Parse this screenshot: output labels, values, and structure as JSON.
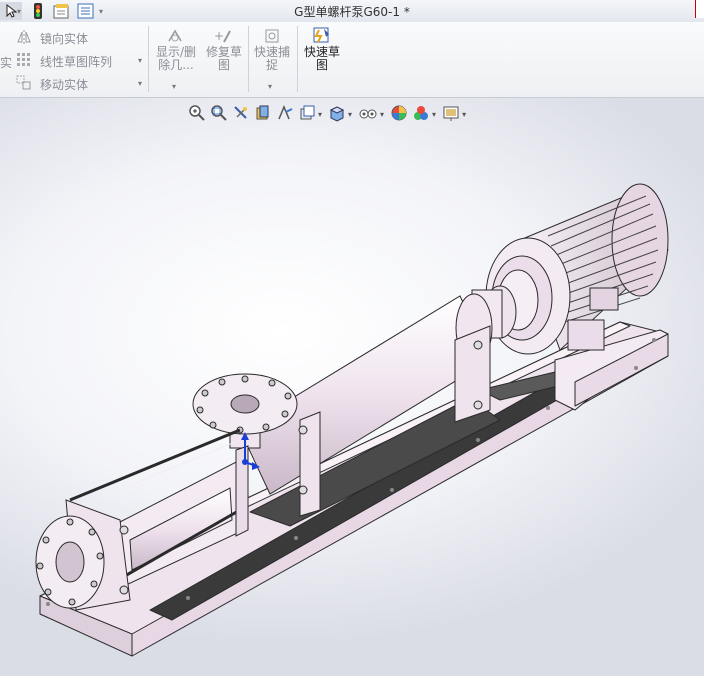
{
  "window": {
    "title": "G型单螺杆泵G60-1 *"
  },
  "quick_access": {
    "icons": [
      "select-arrow-icon",
      "traffic-light-icon",
      "file-properties-icon",
      "options-list-icon"
    ]
  },
  "ribbon": {
    "left_cut_label": "实",
    "mirror_label": "镜向实体",
    "linear_pattern_label": "线性草图阵列",
    "move_label": "移动实体",
    "display_delete_label": "显示/删除几...",
    "repair_sketch_label": "修复草图",
    "quick_snap_label": "快速捕捉",
    "rapid_sketch_label": "快速草图"
  },
  "heads_up_toolbar": {
    "icons": [
      "zoom-to-fit-icon",
      "zoom-to-area-icon",
      "previous-view-icon",
      "section-view-icon",
      "dynamic-annotation-icon",
      "view-orientation-icon",
      "display-style-icon",
      "hide-show-items-icon",
      "edit-appearance-icon",
      "apply-scene-icon",
      "view-settings-icon"
    ]
  },
  "colors": {
    "part_tint": "#efe3ee",
    "part_edge": "#2a2a2a",
    "shadow": "#3a3a3a",
    "triad_blue": "#1a3fd6"
  }
}
